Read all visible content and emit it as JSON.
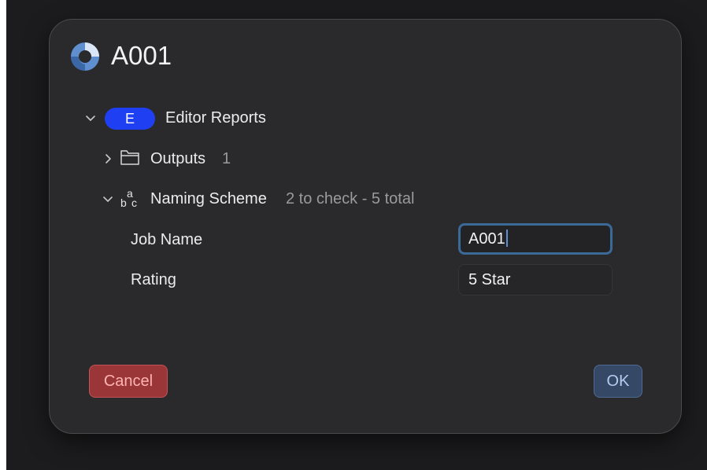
{
  "dialog": {
    "title": "A001",
    "app_icon": "app-logo-icon"
  },
  "tree": {
    "editor_reports": {
      "badge": "E",
      "label": "Editor Reports",
      "expanded": true
    },
    "outputs": {
      "label": "Outputs",
      "count": "1",
      "icon": "folder-icon",
      "expanded": false
    },
    "naming_scheme": {
      "label": "Naming Scheme",
      "summary": "2 to check - 5 total",
      "icon": "abc-icon",
      "expanded": true
    }
  },
  "fields": [
    {
      "label": "Job Name",
      "value": "A001",
      "focused": true
    },
    {
      "label": "Rating",
      "value": "5 Star",
      "focused": false
    }
  ],
  "buttons": {
    "cancel": "Cancel",
    "ok": "OK"
  },
  "colors": {
    "badge": "#1f3ff2",
    "cancel": "#9a3638",
    "ok": "#354866",
    "focus_ring": "#3b6a98"
  }
}
